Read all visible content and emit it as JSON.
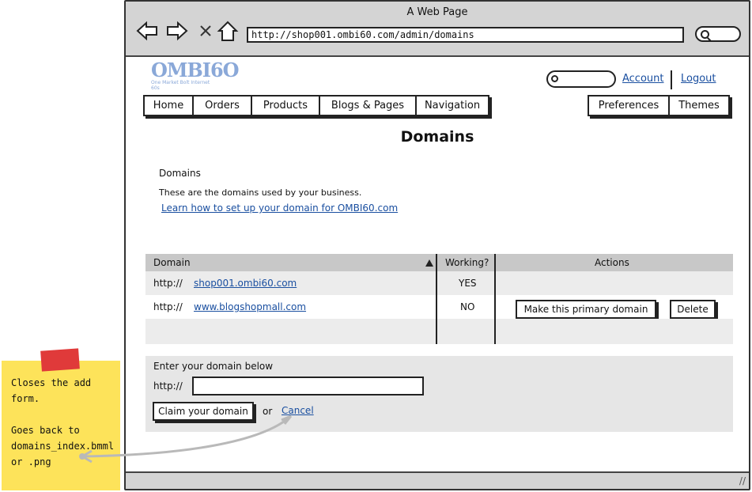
{
  "browser": {
    "title": "A Web Page",
    "url": "http://shop001.ombi60.com/admin/domains",
    "icons": [
      "back-arrow-icon",
      "forward-arrow-icon",
      "close-x-icon",
      "home-icon",
      "search-icon"
    ]
  },
  "logo": {
    "main": "OMBI6O",
    "sub": "One Market Bolt Internet 60s"
  },
  "topbar": {
    "account": "Account",
    "logout": "Logout"
  },
  "nav": {
    "left": [
      "Home",
      "Orders",
      "Products",
      "Blogs & Pages",
      "Navigation"
    ],
    "right": [
      "Preferences",
      "Themes"
    ]
  },
  "page": {
    "title": "Domains",
    "section_title": "Domains",
    "description": "These are the domains used by your business.",
    "learn_link": "Learn how to set up your domain for OMBI60.com"
  },
  "table": {
    "headers": {
      "domain": "Domain",
      "working": "Working?",
      "actions": "Actions"
    },
    "rows": [
      {
        "prefix": "http://",
        "domain": "shop001.ombi60.com",
        "working": "YES",
        "actions": []
      },
      {
        "prefix": "http://",
        "domain": "www.blogshopmall.com",
        "working": "NO",
        "actions": [
          "Make this primary domain",
          "Delete"
        ]
      }
    ]
  },
  "add_form": {
    "label": "Enter your domain below",
    "prefix": "http://",
    "value": "",
    "claim_button": "Claim your domain",
    "or_text": "or",
    "cancel_link": "Cancel"
  },
  "note": {
    "line1": "Closes the add form.",
    "line2": "Goes back to domains_index.bmml or .png",
    "colors": {
      "paper": "#fde35a",
      "tape": "#e03a3a"
    }
  },
  "colors": {
    "link": "#1a4fa0",
    "header_bg": "#c8c8c8",
    "chrome_bg": "#d4d4d4"
  }
}
